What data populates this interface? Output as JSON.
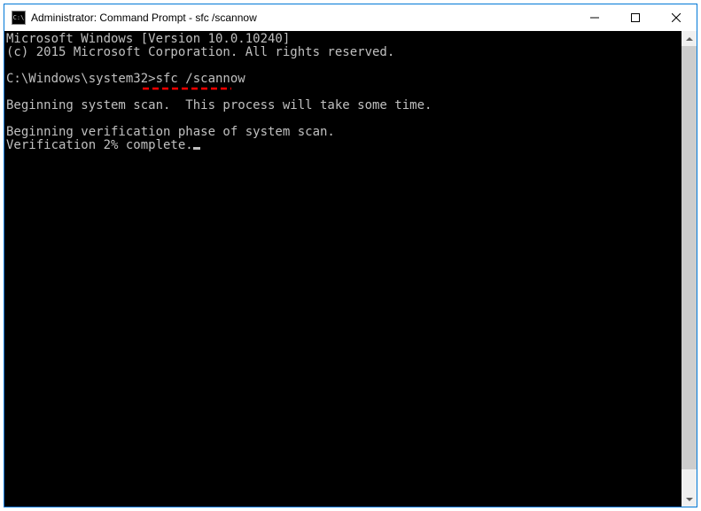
{
  "window": {
    "title": "Administrator: Command Prompt - sfc  /scannow"
  },
  "console": {
    "line1": "Microsoft Windows [Version 10.0.10240]",
    "line2": "(c) 2015 Microsoft Corporation. All rights reserved.",
    "blank1": "",
    "prompt": "C:\\Windows\\system32>",
    "command": "sfc /scannow",
    "blank2": "",
    "line3": "Beginning system scan.  This process will take some time.",
    "blank3": "",
    "line4": "Beginning verification phase of system scan.",
    "line5": "Verification 2% complete."
  },
  "annotation": {
    "color": "#ff0000"
  }
}
